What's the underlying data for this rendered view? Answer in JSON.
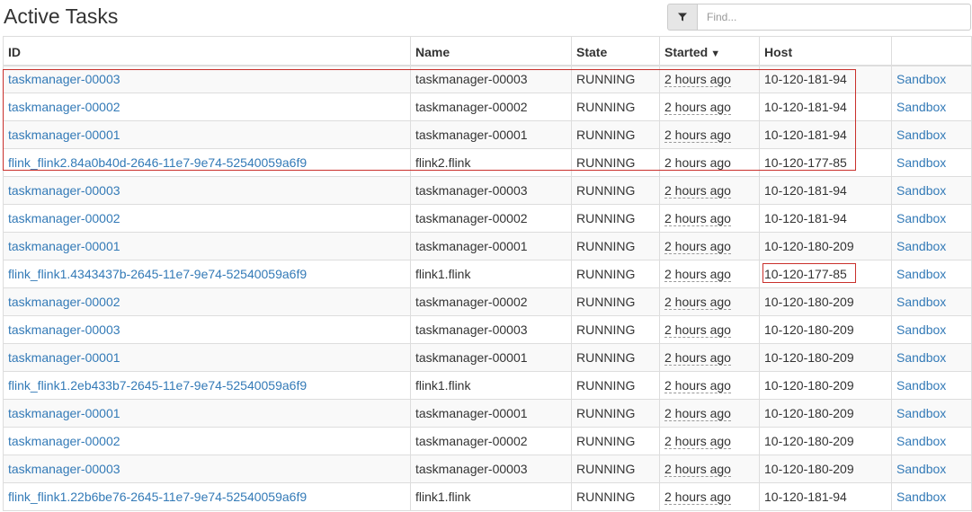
{
  "header": {
    "title": "Active Tasks",
    "filter_icon": "filter-icon",
    "search_placeholder": "Find..."
  },
  "table": {
    "columns": {
      "id": "ID",
      "name": "Name",
      "state": "State",
      "started": "Started",
      "started_sort_indicator": "▼",
      "host": "Host",
      "actions": ""
    },
    "rows": [
      {
        "id": "taskmanager-00003",
        "name": "taskmanager-00003",
        "state": "RUNNING",
        "started": "2 hours ago",
        "host": "10-120-181-94",
        "action": "Sandbox"
      },
      {
        "id": "taskmanager-00002",
        "name": "taskmanager-00002",
        "state": "RUNNING",
        "started": "2 hours ago",
        "host": "10-120-181-94",
        "action": "Sandbox"
      },
      {
        "id": "taskmanager-00001",
        "name": "taskmanager-00001",
        "state": "RUNNING",
        "started": "2 hours ago",
        "host": "10-120-181-94",
        "action": "Sandbox"
      },
      {
        "id": "flink_flink2.84a0b40d-2646-11e7-9e74-52540059a6f9",
        "name": "flink2.flink",
        "state": "RUNNING",
        "started": "2 hours ago",
        "host": "10-120-177-85",
        "action": "Sandbox"
      },
      {
        "id": "taskmanager-00003",
        "name": "taskmanager-00003",
        "state": "RUNNING",
        "started": "2 hours ago",
        "host": "10-120-181-94",
        "action": "Sandbox"
      },
      {
        "id": "taskmanager-00002",
        "name": "taskmanager-00002",
        "state": "RUNNING",
        "started": "2 hours ago",
        "host": "10-120-181-94",
        "action": "Sandbox"
      },
      {
        "id": "taskmanager-00001",
        "name": "taskmanager-00001",
        "state": "RUNNING",
        "started": "2 hours ago",
        "host": "10-120-180-209",
        "action": "Sandbox"
      },
      {
        "id": "flink_flink1.4343437b-2645-11e7-9e74-52540059a6f9",
        "name": "flink1.flink",
        "state": "RUNNING",
        "started": "2 hours ago",
        "host": "10-120-177-85",
        "action": "Sandbox"
      },
      {
        "id": "taskmanager-00002",
        "name": "taskmanager-00002",
        "state": "RUNNING",
        "started": "2 hours ago",
        "host": "10-120-180-209",
        "action": "Sandbox"
      },
      {
        "id": "taskmanager-00003",
        "name": "taskmanager-00003",
        "state": "RUNNING",
        "started": "2 hours ago",
        "host": "10-120-180-209",
        "action": "Sandbox"
      },
      {
        "id": "taskmanager-00001",
        "name": "taskmanager-00001",
        "state": "RUNNING",
        "started": "2 hours ago",
        "host": "10-120-180-209",
        "action": "Sandbox"
      },
      {
        "id": "flink_flink1.2eb433b7-2645-11e7-9e74-52540059a6f9",
        "name": "flink1.flink",
        "state": "RUNNING",
        "started": "2 hours ago",
        "host": "10-120-180-209",
        "action": "Sandbox"
      },
      {
        "id": "taskmanager-00001",
        "name": "taskmanager-00001",
        "state": "RUNNING",
        "started": "2 hours ago",
        "host": "10-120-180-209",
        "action": "Sandbox"
      },
      {
        "id": "taskmanager-00002",
        "name": "taskmanager-00002",
        "state": "RUNNING",
        "started": "2 hours ago",
        "host": "10-120-180-209",
        "action": "Sandbox"
      },
      {
        "id": "taskmanager-00003",
        "name": "taskmanager-00003",
        "state": "RUNNING",
        "started": "2 hours ago",
        "host": "10-120-180-209",
        "action": "Sandbox"
      },
      {
        "id": "flink_flink1.22b6be76-2645-11e7-9e74-52540059a6f9",
        "name": "flink1.flink",
        "state": "RUNNING",
        "started": "2 hours ago",
        "host": "10-120-181-94",
        "action": "Sandbox"
      }
    ]
  },
  "colors": {
    "link": "#337ab7",
    "highlight_border": "#c9302c",
    "stripe": "#f9f9f9",
    "border": "#dddddd"
  }
}
